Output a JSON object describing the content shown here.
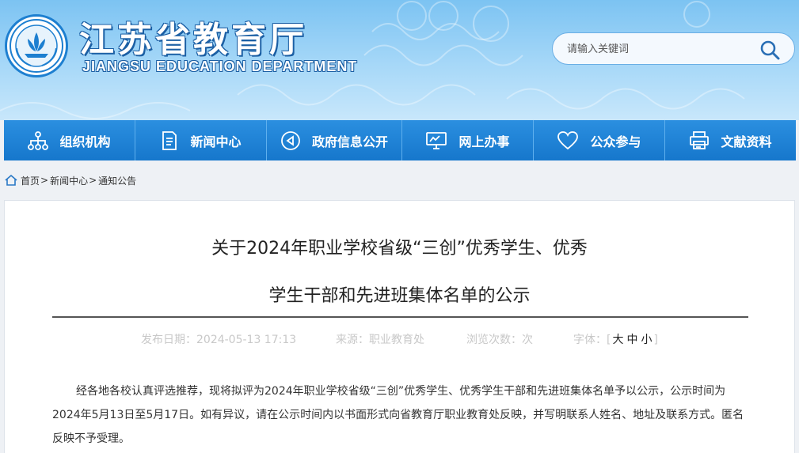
{
  "header": {
    "title": "江苏省教育厅",
    "subtitle": "JIANGSU EDUCATION DEPARTMENT",
    "logo_icon": "provincial-emblem-icon"
  },
  "search": {
    "placeholder": "请输入关键词",
    "icon": "search-icon"
  },
  "nav": {
    "items": [
      {
        "label": "组织机构",
        "icon": "org-chart-icon"
      },
      {
        "label": "新闻中心",
        "icon": "document-icon"
      },
      {
        "label": "政府信息公开",
        "icon": "play-circle-icon"
      },
      {
        "label": "网上办事",
        "icon": "monitor-icon"
      },
      {
        "label": "公众参与",
        "icon": "heart-icon"
      },
      {
        "label": "文献资料",
        "icon": "printer-icon"
      }
    ]
  },
  "breadcrumb": {
    "home": "首页",
    "level1": "新闻中心",
    "level2": "通知公告",
    "separator": ">"
  },
  "article": {
    "title_line1": "关于2024年职业学校省级“三创”优秀学生、优秀",
    "title_line2": "学生干部和先进班集体名单的公示",
    "meta": {
      "date": "发布日期：2024-05-13 17:13",
      "source": "来源：职业教育处",
      "views": "浏览次数：次",
      "font_label": "字体：[",
      "font_large": "大",
      "font_medium": "中",
      "font_small": "小",
      "font_close": "]"
    },
    "paragraph": "经各地各校认真评选推荐，现将拟评为2024年职业学校省级“三创”优秀学生、优秀学生干部和先进班集体名单予以公示，公示时间为2024年5月13日至5月17日。如有异议，请在公示时间内以书面形式向省教育厅职业教育处反映，并写明联系人姓名、地址及联系方式。匿名反映不予受理。"
  },
  "colors": {
    "nav_bg": "#1b7fd4",
    "header_bg": "#8ecbf5",
    "title_outline": "#1b5fa4"
  }
}
